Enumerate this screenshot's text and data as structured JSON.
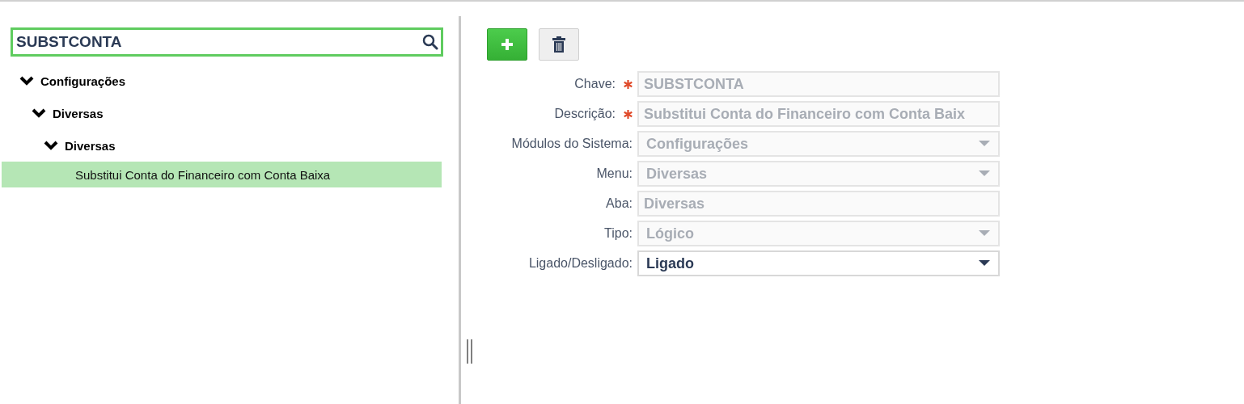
{
  "search": {
    "value": "SUBSTCONTA"
  },
  "tree": [
    {
      "label": "Configurações",
      "expanded": true,
      "selected": false,
      "children": [
        {
          "label": "Diversas",
          "expanded": true,
          "selected": false,
          "children": [
            {
              "label": "Diversas",
              "expanded": true,
              "selected": false,
              "children": [
                {
                  "label": "Substitui Conta do Financeiro com Conta Baixa",
                  "selected": true
                }
              ]
            }
          ]
        }
      ]
    }
  ],
  "toolbar": [
    {
      "kind": "add"
    },
    {
      "kind": "delete"
    }
  ],
  "fields": [
    {
      "label": "Chave:",
      "kind": "text",
      "required": true,
      "disabled": true,
      "value": "SUBSTCONTA"
    },
    {
      "label": "Descrição:",
      "kind": "text",
      "required": true,
      "disabled": true,
      "value": "Substitui Conta do Financeiro com Conta Baix"
    },
    {
      "label": "Módulos do Sistema:",
      "kind": "select",
      "required": false,
      "disabled": true,
      "value": "Configurações"
    },
    {
      "label": "Menu:",
      "kind": "select",
      "required": false,
      "disabled": true,
      "value": "Diversas"
    },
    {
      "label": "Aba:",
      "kind": "text",
      "required": false,
      "disabled": true,
      "value": "Diversas"
    },
    {
      "label": "Tipo:",
      "kind": "select",
      "required": false,
      "disabled": true,
      "value": "Lógico"
    },
    {
      "label": "Ligado/Desligado:",
      "kind": "select",
      "required": false,
      "disabled": false,
      "value": "Ligado"
    }
  ]
}
